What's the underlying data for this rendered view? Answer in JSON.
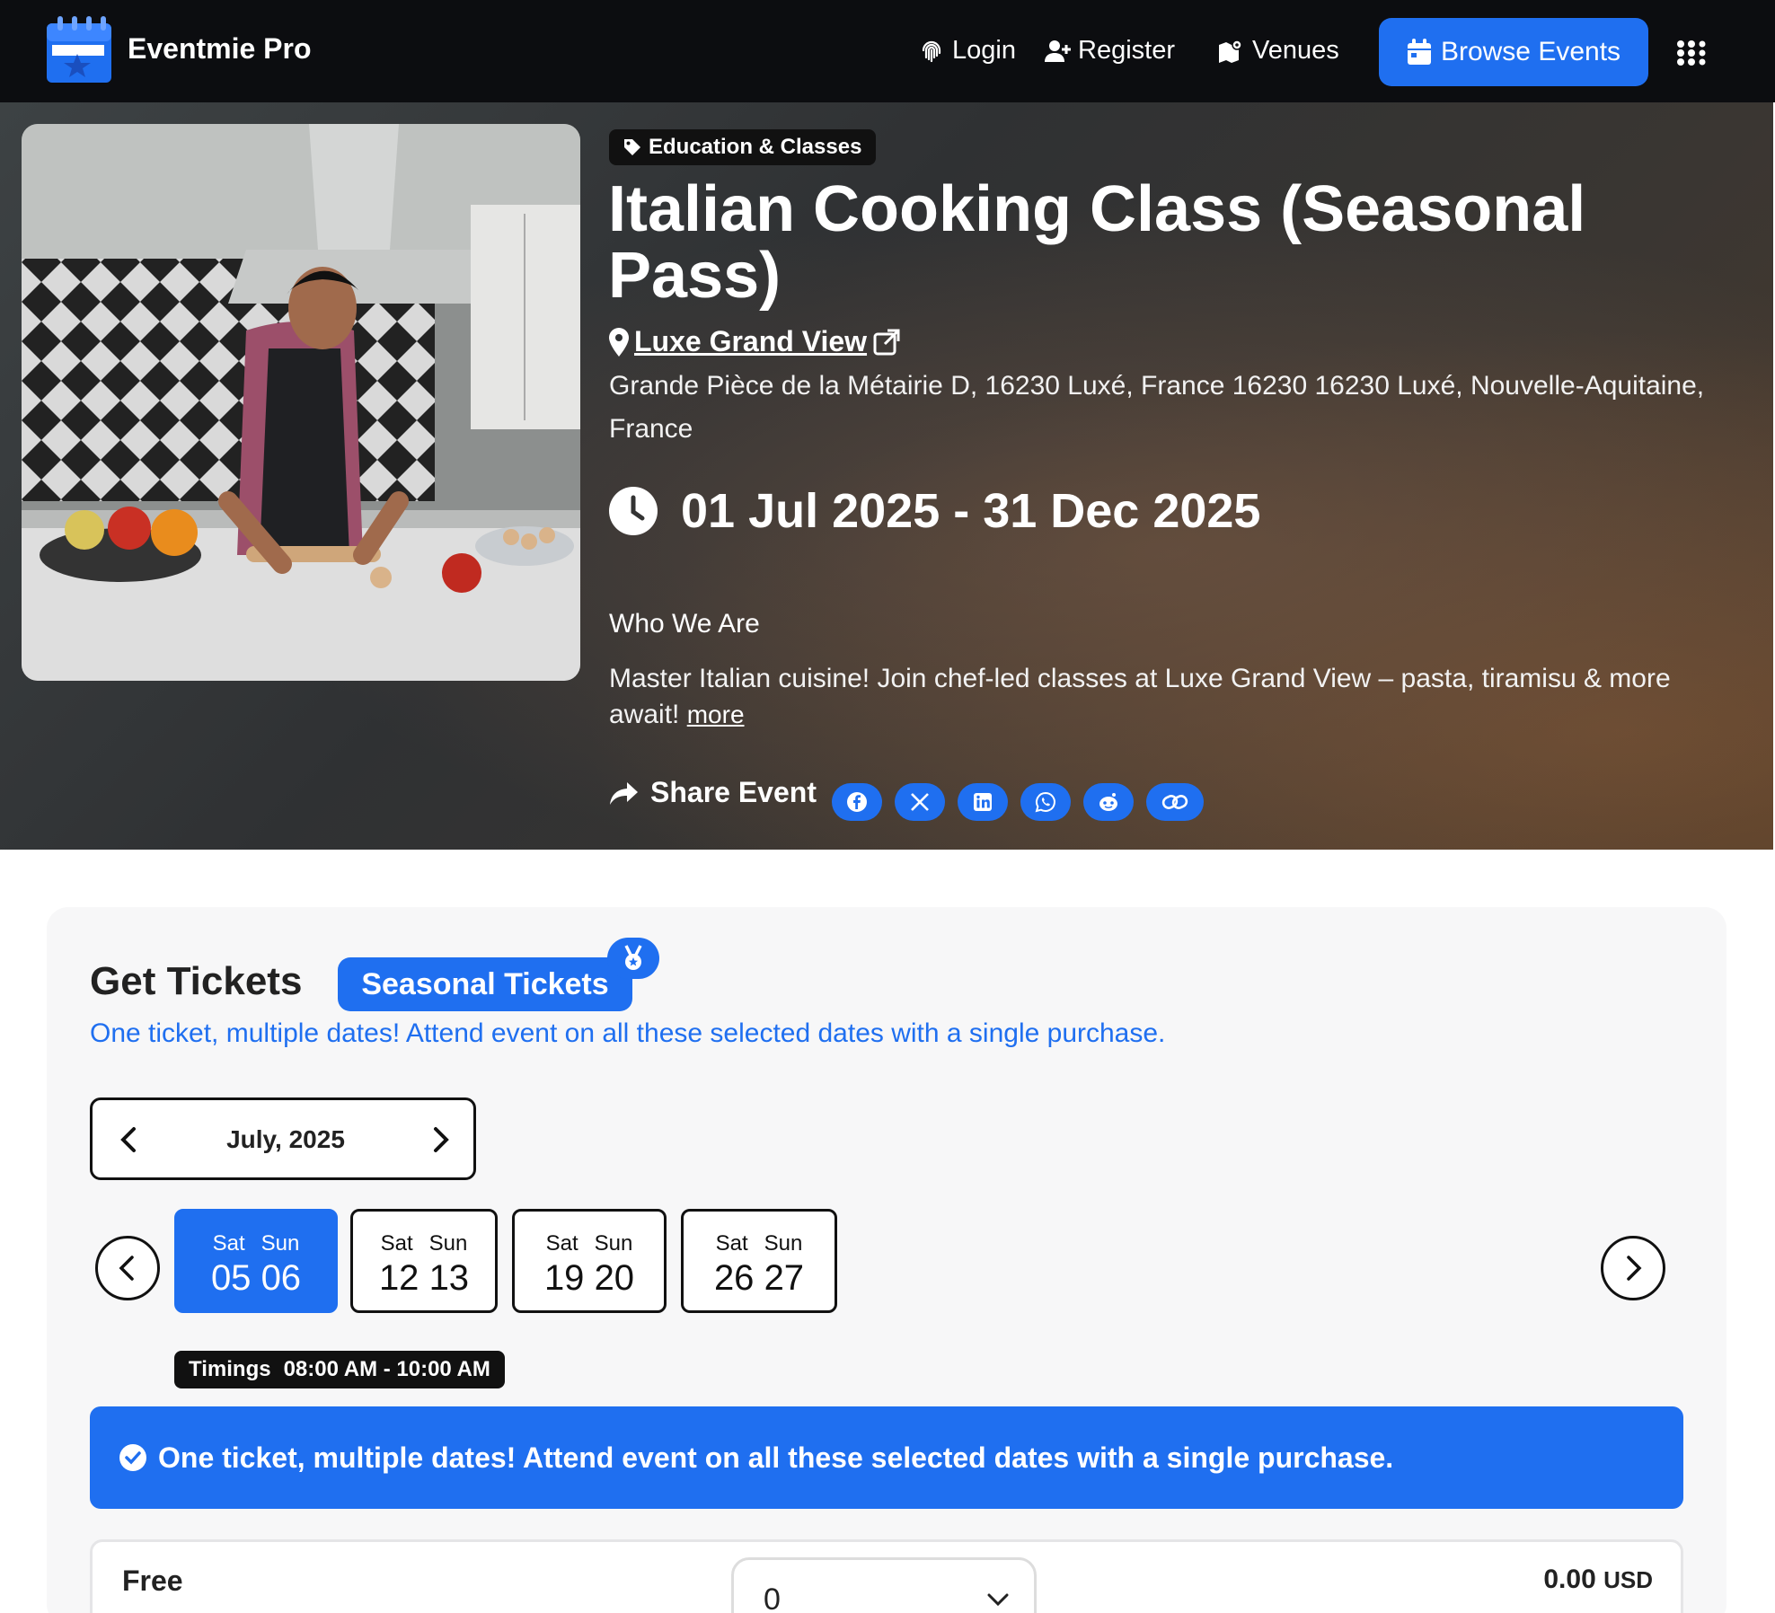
{
  "brand": {
    "name": "Eventmie Pro"
  },
  "nav": {
    "login": "Login",
    "register": "Register",
    "venues": "Venues",
    "browse": "Browse Events"
  },
  "event": {
    "category": "Education & Classes",
    "title": "Italian Cooking Class (Seasonal Pass)",
    "venue": "Luxe Grand View",
    "address": "Grande Pièce de la Métairie D, 16230 Luxé, France 16230 16230 Luxé, Nouvelle-Aquitaine, France",
    "dates": "01 Jul 2025 - 31 Dec 2025",
    "about_heading": "Who We Are",
    "about_text": "Master Italian cuisine! Join chef-led classes at Luxe Grand View – pasta, tiramisu & more await!",
    "more_link": "more",
    "share_label": "Share Event"
  },
  "tickets": {
    "title": "Get Tickets",
    "badge": "Seasonal Tickets",
    "subtitle": "One ticket, multiple dates! Attend event on all these selected dates with a single purchase.",
    "month": "July, 2025",
    "weeks": [
      {
        "d1": "Sat",
        "d2": "Sun",
        "n1": "05",
        "n2": "06",
        "selected": true
      },
      {
        "d1": "Sat",
        "d2": "Sun",
        "n1": "12",
        "n2": "13",
        "selected": false
      },
      {
        "d1": "Sat",
        "d2": "Sun",
        "n1": "19",
        "n2": "20",
        "selected": false
      },
      {
        "d1": "Sat",
        "d2": "Sun",
        "n1": "26",
        "n2": "27",
        "selected": false
      }
    ],
    "timings_label": "Timings",
    "timings_value": "08:00 AM - 10:00 AM",
    "banner": "One ticket, multiple dates! Attend event on all these selected dates with a single purchase.",
    "row": {
      "name": "Free",
      "quantity": "0",
      "price": "0.00",
      "currency": "USD"
    }
  },
  "colors": {
    "accent": "#1f6ff0",
    "nav_bg": "#0c0d10"
  }
}
